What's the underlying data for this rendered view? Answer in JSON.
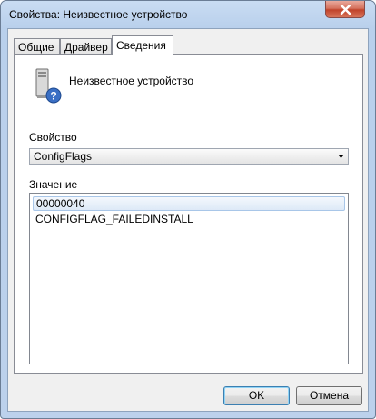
{
  "window": {
    "title": "Свойства: Неизвестное устройство"
  },
  "tabs": [
    {
      "label": "Общие"
    },
    {
      "label": "Драйвер"
    },
    {
      "label": "Сведения",
      "active": true
    }
  ],
  "device": {
    "name": "Неизвестное устройство",
    "icon": "unknown-device-icon"
  },
  "property": {
    "label": "Свойство",
    "selected": "ConfigFlags"
  },
  "value": {
    "label": "Значение",
    "items": [
      "00000040",
      "CONFIGFLAG_FAILEDINSTALL"
    ],
    "selected_index": 0
  },
  "buttons": {
    "ok": "OK",
    "cancel": "Отмена"
  }
}
